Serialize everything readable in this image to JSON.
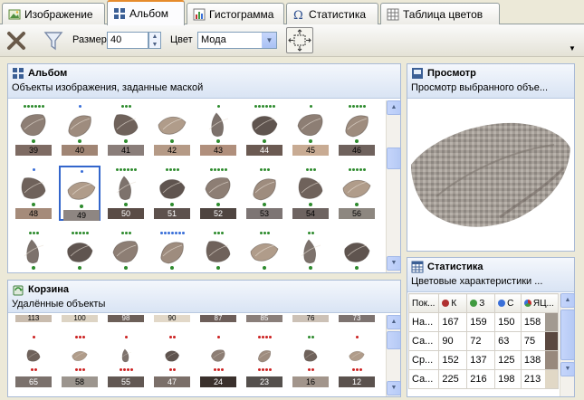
{
  "tabs": [
    {
      "label": "Изображение",
      "icon": "image-icon",
      "active": false
    },
    {
      "label": "Альбом",
      "icon": "album-icon",
      "active": true
    },
    {
      "label": "Гистограмма",
      "icon": "histogram-icon",
      "active": false
    },
    {
      "label": "Статистика",
      "icon": "omega-icon",
      "active": false
    },
    {
      "label": "Таблица цветов",
      "icon": "color-table-icon",
      "active": false
    }
  ],
  "toolbar": {
    "size_label": "Размер",
    "size_value": "40",
    "color_label": "Цвет",
    "color_value": "Мода",
    "delete_icon": "x-icon",
    "filter_icon": "filter-icon",
    "fit_icon": "fit-icon"
  },
  "album": {
    "title": "Альбом",
    "subtitle": "Объекты изображения, заданные маской",
    "rows": [
      [
        {
          "num": "39",
          "color": "#7e6b63",
          "dots": 6,
          "dotcolor": "#2e8b2e",
          "sdot": "#2e8b2e"
        },
        {
          "num": "40",
          "color": "#a08574",
          "dots": 1,
          "dotcolor": "#3a6fd8",
          "sdot": "#2e8b2e"
        },
        {
          "num": "41",
          "color": "#8a7e7a",
          "dots": 3,
          "dotcolor": "#2e8b2e",
          "sdot": "#2e8b2e"
        },
        {
          "num": "42",
          "color": "#b59a86",
          "dots": 0,
          "dotcolor": "#2e8b2e",
          "sdot": "#2e8b2e"
        },
        {
          "num": "43",
          "color": "#b08f7c",
          "dots": 1,
          "dotcolor": "#2e8b2e",
          "sdot": "#2e8b2e"
        },
        {
          "num": "44",
          "color": "#6b5a52",
          "dots": 6,
          "dotcolor": "#2e8b2e",
          "sdot": "#2e8b2e"
        },
        {
          "num": "45",
          "color": "#c8ab93",
          "dots": 1,
          "dotcolor": "#2e8b2e",
          "sdot": "#2e8b2e"
        },
        {
          "num": "46",
          "color": "#6f625d",
          "dots": 5,
          "dotcolor": "#2e8b2e",
          "sdot": "#2e8b2e"
        }
      ],
      [
        {
          "num": "48",
          "color": "#a58b7a",
          "dots": 1,
          "dotcolor": "#3a6fd8",
          "sdot": "#2e8b2e"
        },
        {
          "num": "49",
          "color": "#8e8682",
          "dots": 1,
          "dotcolor": "#3a6fd8",
          "sdot": "#2e8b2e"
        },
        {
          "num": "50",
          "color": "#5a4c46",
          "dots": 6,
          "dotcolor": "#2e8b2e",
          "sdot": "#2e8b2e"
        },
        {
          "num": "51",
          "color": "#5d514d",
          "dots": 4,
          "dotcolor": "#2e8b2e",
          "sdot": "#2e8b2e"
        },
        {
          "num": "52",
          "color": "#4f4540",
          "dots": 5,
          "dotcolor": "#2e8b2e",
          "sdot": "#2e8b2e"
        },
        {
          "num": "53",
          "color": "#7d7574",
          "dots": 3,
          "dotcolor": "#2e8b2e",
          "sdot": "#2e8b2e"
        },
        {
          "num": "54",
          "color": "#6e6461",
          "dots": 3,
          "dotcolor": "#2e8b2e",
          "sdot": "#2e8b2e"
        },
        {
          "num": "56",
          "color": "#8d8780",
          "dots": 5,
          "dotcolor": "#2e8b2e",
          "sdot": "#2e8b2e"
        }
      ],
      [
        {
          "num": "",
          "color": "#ffffff",
          "dots": 3,
          "dotcolor": "#2e8b2e",
          "sdot": "#2e8b2e"
        },
        {
          "num": "",
          "color": "#ffffff",
          "dots": 5,
          "dotcolor": "#2e8b2e",
          "sdot": "#2e8b2e"
        },
        {
          "num": "",
          "color": "#ffffff",
          "dots": 3,
          "dotcolor": "#2e8b2e",
          "sdot": "#2e8b2e"
        },
        {
          "num": "",
          "color": "#ffffff",
          "dots": 7,
          "dotcolor": "#3a6fd8",
          "sdot": "#2e8b2e"
        },
        {
          "num": "",
          "color": "#ffffff",
          "dots": 3,
          "dotcolor": "#2e8b2e",
          "sdot": "#2e8b2e"
        },
        {
          "num": "",
          "color": "#ffffff",
          "dots": 3,
          "dotcolor": "#2e8b2e",
          "sdot": "#2e8b2e"
        },
        {
          "num": "",
          "color": "#ffffff",
          "dots": 2,
          "dotcolor": "#2e8b2e",
          "sdot": "#2e8b2e"
        },
        {
          "num": "",
          "color": "#ffffff",
          "dots": 0,
          "dotcolor": "#2e8b2e",
          "sdot": "#2e8b2e"
        }
      ]
    ]
  },
  "trash": {
    "title": "Корзина",
    "subtitle": "Удалённые объекты",
    "top_numbers": [
      "113",
      "100",
      "98",
      "90",
      "87",
      "85",
      "76",
      "73"
    ],
    "top_colors": [
      "#c9bcae",
      "#ddd4c4",
      "#6c5f58",
      "#e2d8c8",
      "#6d5e59",
      "#8a7f7a",
      "#ccc1b6",
      "#7d7370"
    ],
    "items": [
      {
        "num": "65",
        "color": "#7b716c",
        "dots": 1,
        "dotcolor": "#cc2222"
      },
      {
        "num": "58",
        "color": "#9c958e",
        "dots": 3,
        "dotcolor": "#cc2222"
      },
      {
        "num": "55",
        "color": "#625853",
        "dots": 1,
        "dotcolor": "#cc2222"
      },
      {
        "num": "47",
        "color": "#7b6f69",
        "dots": 2,
        "dotcolor": "#cc2222"
      },
      {
        "num": "24",
        "color": "#3a302c",
        "dots": 1,
        "dotcolor": "#cc2222"
      },
      {
        "num": "23",
        "color": "#55504d",
        "dots": 4,
        "dotcolor": "#cc2222"
      },
      {
        "num": "16",
        "color": "#a2958b",
        "dots": 2,
        "dotcolor": "#2e8b2e"
      },
      {
        "num": "12",
        "color": "#5b524e",
        "dots": 1,
        "dotcolor": "#cc2222"
      }
    ]
  },
  "preview": {
    "title": "Просмотр",
    "subtitle": "Просмотр выбранного объе..."
  },
  "stats": {
    "title": "Статистика",
    "subtitle": "Цветовые характеристики ...",
    "headers": [
      "Пок...",
      "К",
      "З",
      "С",
      "ЯЦ..."
    ],
    "header_colors": [
      "#b03030",
      "#3f9a3f",
      "#3a6fd8"
    ],
    "rows": [
      {
        "label": "На...",
        "r": "167",
        "g": "159",
        "b": "150",
        "y": "158",
        "swatch": "#a29a91"
      },
      {
        "label": "Са...",
        "r": "90",
        "g": "72",
        "b": "63",
        "y": "75",
        "swatch": "#5a4840"
      },
      {
        "label": "Ср...",
        "r": "152",
        "g": "137",
        "b": "125",
        "y": "138",
        "swatch": "#98897d"
      },
      {
        "label": "Са...",
        "r": "225",
        "g": "216",
        "b": "198",
        "y": "213",
        "swatch": "#e1d8c6"
      }
    ]
  }
}
